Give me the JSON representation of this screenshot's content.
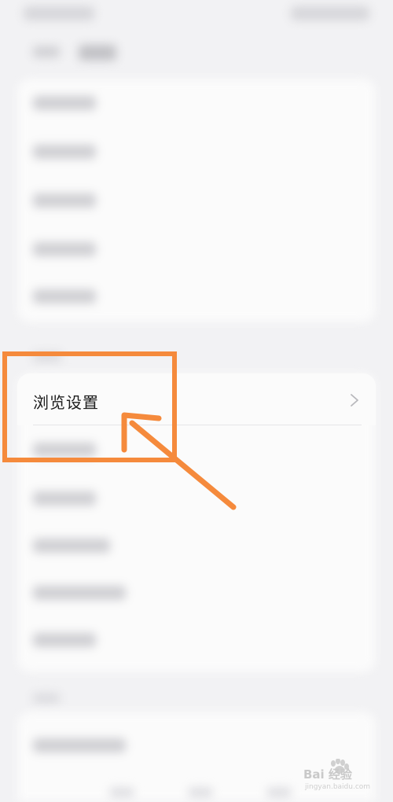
{
  "settings": {
    "highlighted_item": {
      "label": "浏览设置",
      "icon": "chevron-right-icon"
    }
  },
  "annotation": {
    "highlight_color": "#f58a3c",
    "arrow_color": "#f58a3c"
  },
  "watermark": {
    "brand": "Bai 经验",
    "sub": "jingyan.baidu.com"
  },
  "colors": {
    "background": "#f2f2f4",
    "card": "#fbfbfb"
  }
}
